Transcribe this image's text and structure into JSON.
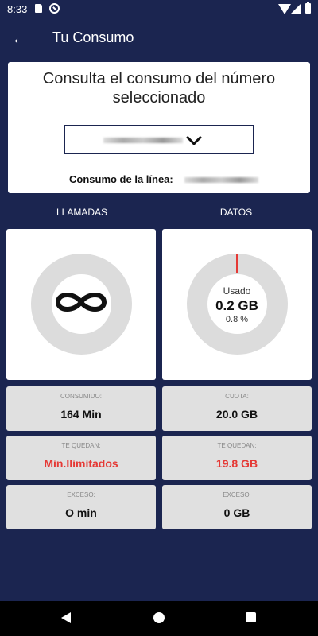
{
  "status_bar": {
    "time": "8:33"
  },
  "app_bar": {
    "title": "Tu Consumo"
  },
  "query_card": {
    "title": "Consulta el consumo del número seleccionado",
    "line_label": "Consumo de la línea:"
  },
  "columns": {
    "left": "LLAMADAS",
    "right": "DATOS"
  },
  "data_chart": {
    "label": "Usado",
    "value": "0.2 GB",
    "percent": "0.8 %",
    "used_fraction": 0.008,
    "track_color": "#dcdcdc",
    "used_color": "#e53935"
  },
  "calls": {
    "consumed": {
      "label": "CONSUMIDO:",
      "value": "164 Min"
    },
    "remaining": {
      "label": "TE QUEDAN:",
      "value": "Min.Ilimitados"
    },
    "excess": {
      "label": "EXCESO:",
      "value": "O min"
    }
  },
  "data": {
    "quota": {
      "label": "CUOTA:",
      "value": "20.0 GB"
    },
    "remaining": {
      "label": "TE QUEDAN:",
      "value": "19.8 GB"
    },
    "excess": {
      "label": "EXCESO:",
      "value": "0 GB"
    }
  },
  "colors": {
    "background": "#1b2550",
    "accent_red": "#e53935"
  }
}
